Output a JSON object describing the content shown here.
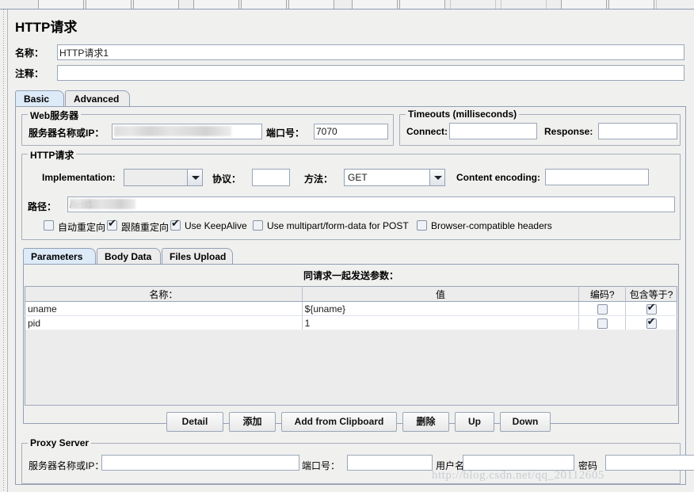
{
  "window": {
    "title": "HTTP请求",
    "watermark": "http://blog.csdn.net/qq_20112605"
  },
  "header": {
    "name_label": "名称：",
    "name_value": "HTTP请求1",
    "comment_label": "注释：",
    "comment_value": ""
  },
  "main_tabs": [
    {
      "label": "Basic",
      "selected": true
    },
    {
      "label": "Advanced",
      "selected": false
    }
  ],
  "web_server": {
    "group_label": "Web服务器",
    "server_label": "服务器名称或IP：",
    "server_value": "",
    "port_label": "端口号：",
    "port_value": "7070"
  },
  "timeouts": {
    "group_label": "Timeouts (milliseconds)",
    "connect_label": "Connect:",
    "connect_value": "",
    "response_label": "Response:",
    "response_value": ""
  },
  "http_request": {
    "group_label": "HTTP请求",
    "implementation_label": "Implementation:",
    "implementation_value": "",
    "protocol_label": "协议：",
    "protocol_value": "",
    "method_label": "方法：",
    "method_value": "GET",
    "content_encoding_label": "Content encoding:",
    "content_encoding_value": "",
    "path_label": "路径：",
    "path_value": "/test1",
    "checkboxes": [
      {
        "label": "自动重定向",
        "checked": false
      },
      {
        "label": "跟随重定向",
        "checked": true
      },
      {
        "label": "Use KeepAlive",
        "checked": true
      },
      {
        "label": "Use multipart/form-data for POST",
        "checked": false
      },
      {
        "label": "Browser-compatible headers",
        "checked": false
      }
    ]
  },
  "sub_tabs": [
    {
      "label": "Parameters",
      "selected": true
    },
    {
      "label": "Body Data",
      "selected": false
    },
    {
      "label": "Files Upload",
      "selected": false
    }
  ],
  "parameters": {
    "caption": "同请求一起发送参数：",
    "columns": [
      "名称：",
      "值",
      "编码?",
      "包含等于?"
    ],
    "rows": [
      {
        "name": "uname",
        "value": "${uname}",
        "encode": false,
        "include_equals": true
      },
      {
        "name": "pid",
        "value": "1",
        "encode": false,
        "include_equals": true
      }
    ]
  },
  "buttons": [
    {
      "label": "Detail"
    },
    {
      "label": "添加"
    },
    {
      "label": "Add from Clipboard"
    },
    {
      "label": "删除"
    },
    {
      "label": "Up"
    },
    {
      "label": "Down"
    }
  ],
  "proxy_server": {
    "group_label": "Proxy Server",
    "server_label": "服务器名称或IP：",
    "server_value": "",
    "port_label": "端口号：",
    "port_value": "",
    "username_label": "用户名",
    "username_value": "",
    "password_label": "密码",
    "password_value": ""
  }
}
